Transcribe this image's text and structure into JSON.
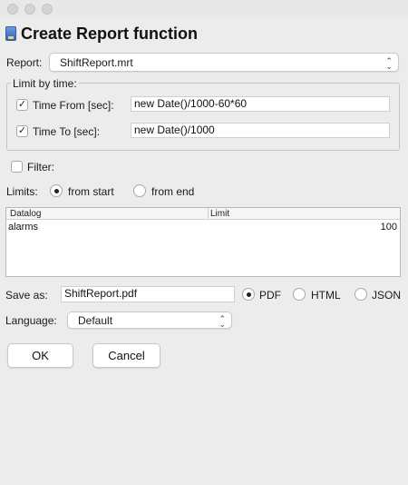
{
  "window": {
    "title": "Create Report function",
    "icon": "report-icon"
  },
  "report": {
    "label": "Report:",
    "selected": "ShiftReport.mrt"
  },
  "time_group": {
    "legend": "Limit by time:",
    "from": {
      "label": "Time From [sec]:",
      "checked": true,
      "value": "new Date()/1000-60*60"
    },
    "to": {
      "label": "Time To [sec]:",
      "checked": true,
      "value": "new Date()/1000"
    }
  },
  "filter": {
    "label": "Filter:",
    "checked": false
  },
  "limits": {
    "label": "Limits:",
    "options": [
      "from start",
      "from end"
    ],
    "selected": "from start"
  },
  "table": {
    "columns": [
      "Datalog",
      "Limit"
    ],
    "rows": [
      {
        "datalog": "alarms",
        "limit": "100"
      }
    ]
  },
  "save_as": {
    "label": "Save as:",
    "value": "ShiftReport.pdf",
    "formats": [
      "PDF",
      "HTML",
      "JSON"
    ],
    "selected": "PDF"
  },
  "language": {
    "label": "Language:",
    "selected": "Default"
  },
  "buttons": {
    "ok": "OK",
    "cancel": "Cancel"
  },
  "glyphs": {
    "check": "✓",
    "chevron_up": "⌃",
    "chevron_down": "⌄"
  }
}
